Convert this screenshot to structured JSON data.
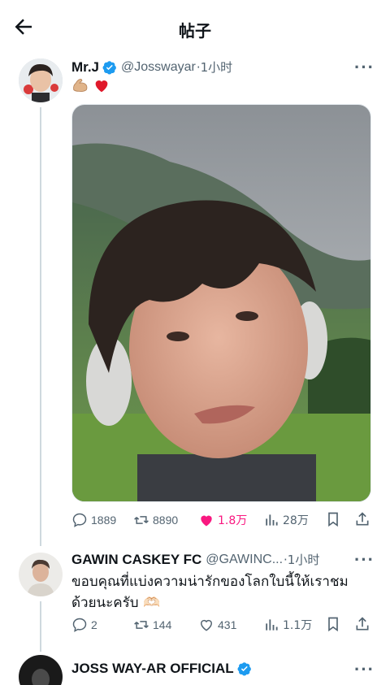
{
  "header": {
    "title": "帖子",
    "back_icon": "arrow-left-icon"
  },
  "post": {
    "author_name": "Mr.J",
    "author_handle": "@Josswayar",
    "time": "·1小时",
    "text_emojis": [
      "flexed-biceps-emoji",
      "red-heart-emoji"
    ],
    "verified": true,
    "stats": {
      "replies": "1889",
      "reposts": "8890",
      "likes": "1.8万",
      "views": "28万"
    },
    "liked": true
  },
  "reply": {
    "author_name": "GAWIN CASKEY FC",
    "author_handle": "@GAWINC...",
    "time": "·1小时",
    "text": "ขอบคุณที่แบ่งความน่ารักของโลกใบนี้ให้เราชมด้วยนะครับ 🫶🏻",
    "stats": {
      "replies": "2",
      "reposts": "144",
      "likes": "431",
      "views": "1.1万"
    }
  },
  "next_post": {
    "author_name": "JOSS WAY-AR OFFICIAL",
    "verified": true
  },
  "colors": {
    "accent": "#1d9bf0",
    "like": "#f91880",
    "muted": "#536471",
    "verified": "#1d9bf0"
  }
}
